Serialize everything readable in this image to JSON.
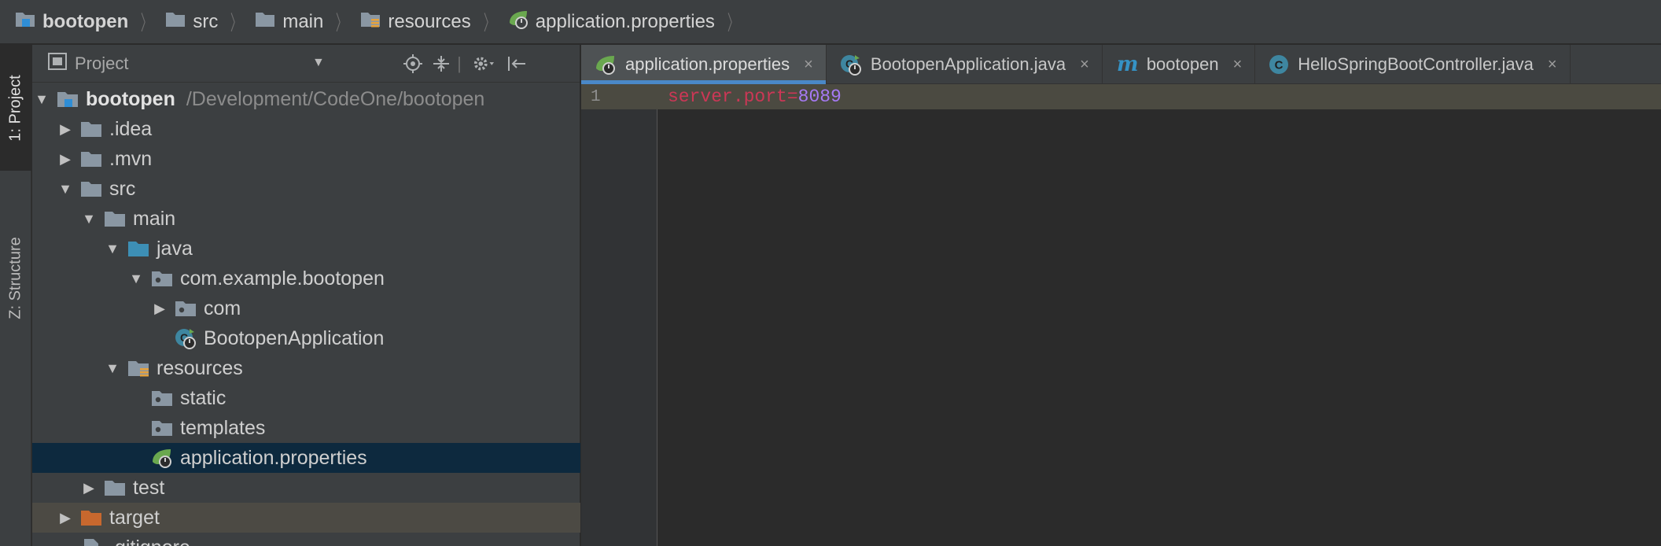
{
  "breadcrumb": [
    {
      "label": "bootopen",
      "icon": "module-folder-icon"
    },
    {
      "label": "src",
      "icon": "folder-icon"
    },
    {
      "label": "main",
      "icon": "folder-icon"
    },
    {
      "label": "resources",
      "icon": "resources-folder-icon"
    },
    {
      "label": "application.properties",
      "icon": "spring-properties-icon"
    }
  ],
  "left_strip": {
    "project_tab": "1: Project",
    "structure_tab": "Z: Structure"
  },
  "project_panel": {
    "title": "Project",
    "dropdown_glyph": "▼",
    "tools": [
      "locate-icon",
      "collapse-all-icon",
      "gear-icon",
      "hide-panel-icon"
    ]
  },
  "tree": [
    {
      "label": "bootopen",
      "hint": "/Development/CodeOne/bootopen",
      "depth": 0,
      "arrow": "▼",
      "icon": "module-folder-icon"
    },
    {
      "label": ".idea",
      "depth": 1,
      "arrow": "▶",
      "icon": "folder-icon"
    },
    {
      "label": ".mvn",
      "depth": 1,
      "arrow": "▶",
      "icon": "folder-icon"
    },
    {
      "label": "src",
      "depth": 1,
      "arrow": "▼",
      "icon": "folder-icon"
    },
    {
      "label": "main",
      "depth": 2,
      "arrow": "▼",
      "icon": "folder-icon"
    },
    {
      "label": "java",
      "depth": 3,
      "arrow": "▼",
      "icon": "source-folder-icon"
    },
    {
      "label": "com.example.bootopen",
      "depth": 4,
      "arrow": "▼",
      "icon": "package-icon"
    },
    {
      "label": "com",
      "depth": 5,
      "arrow": "▶",
      "icon": "package-icon"
    },
    {
      "label": "BootopenApplication",
      "depth": 5,
      "arrow": "",
      "icon": "spring-boot-class-icon"
    },
    {
      "label": "resources",
      "depth": 3,
      "arrow": "▼",
      "icon": "resources-folder-icon"
    },
    {
      "label": "static",
      "depth": 4,
      "arrow": "",
      "icon": "package-icon"
    },
    {
      "label": "templates",
      "depth": 4,
      "arrow": "",
      "icon": "package-icon"
    },
    {
      "label": "application.properties",
      "depth": 4,
      "arrow": "",
      "icon": "spring-properties-icon",
      "selected": true
    },
    {
      "label": "test",
      "depth": 2,
      "arrow": "▶",
      "icon": "folder-icon"
    },
    {
      "label": "target",
      "depth": 1,
      "arrow": "▶",
      "icon": "excluded-folder-icon",
      "excluded": true
    },
    {
      "label": ".gitignore",
      "depth": 1,
      "arrow": "",
      "icon": "file-icon"
    }
  ],
  "tabs": [
    {
      "label": "application.properties",
      "icon": "spring-properties-icon",
      "active": true
    },
    {
      "label": "BootopenApplication.java",
      "icon": "spring-boot-class-icon"
    },
    {
      "label": "bootopen",
      "icon": "maven-icon"
    },
    {
      "label": "HelloSpringBootController.java",
      "icon": "class-icon"
    }
  ],
  "tab_close_glyph": "×",
  "editor": {
    "line_number": "1",
    "key": "server.port=",
    "value": "8089"
  },
  "colors": {
    "breadcrumb_bg": "#3c3f41",
    "selection": "#0d293e",
    "active_tab_underline": "#4a88c7",
    "property_key": "#cc3756",
    "property_value": "#a67af4"
  }
}
